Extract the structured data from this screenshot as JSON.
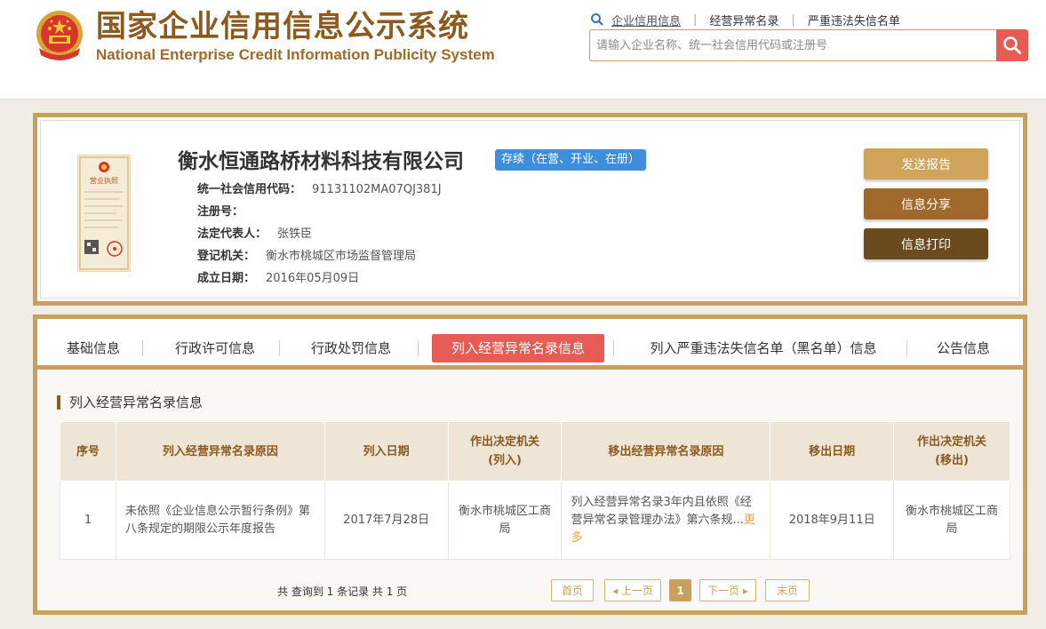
{
  "header": {
    "title_cn": "国家企业信用信息公示系统",
    "title_en": "National Enterprise Credit Information Publicity System",
    "links": [
      {
        "label": "企业信用信息"
      },
      {
        "label": "经营异常名录"
      },
      {
        "label": "严重违法失信名单"
      }
    ],
    "search_placeholder": "请输入企业名称、统一社会信用代码或注册号"
  },
  "company": {
    "name": "衡水恒通路桥材料科技有限公司",
    "status": "存续（在营、开业、在册）",
    "license_label": "营业执照",
    "fields": [
      {
        "label": "统一社会信用代码：",
        "value": "91131102MA07QJ381J"
      },
      {
        "label": "注册号：",
        "value": ""
      },
      {
        "label": "法定代表人：",
        "value": "张铁臣"
      },
      {
        "label": "登记机关：",
        "value": "衡水市桃城区市场监督管理局"
      },
      {
        "label": "成立日期：",
        "value": "2016年05月09日"
      }
    ],
    "actions": {
      "send_report": "发送报告",
      "share": "信息分享",
      "print": "信息打印"
    }
  },
  "tabs": [
    {
      "label": "基础信息"
    },
    {
      "label": "行政许可信息"
    },
    {
      "label": "行政处罚信息"
    },
    {
      "label": "列入经营异常名录信息"
    },
    {
      "label": "列入严重违法失信名单（黑名单）信息"
    },
    {
      "label": "公告信息"
    }
  ],
  "section": {
    "title": "列入经营异常名录信息",
    "columns": [
      {
        "l1": "序号",
        "l2": ""
      },
      {
        "l1": "列入经营异常名录原因",
        "l2": ""
      },
      {
        "l1": "列入日期",
        "l2": ""
      },
      {
        "l1": "作出决定机关",
        "l2": "(列入)"
      },
      {
        "l1": "移出经营异常名录原因",
        "l2": ""
      },
      {
        "l1": "移出日期",
        "l2": ""
      },
      {
        "l1": "作出决定机关",
        "l2": "(移出)"
      }
    ],
    "rows": [
      {
        "no": "1",
        "reason_in": "未依照《企业信息公示暂行条例》第八条规定的期限公示年度报告",
        "date_in": "2017年7月28日",
        "authority_in": "衡水市桃城区工商局",
        "reason_out": "列入经营异常名录3年内且依照《经营异常名录管理办法》第六条规...",
        "more": "更多",
        "date_out": "2018年9月11日",
        "authority_out": "衡水市桃城区工商局"
      }
    ]
  },
  "pagination": {
    "summary": "共 查询到 1 条记录 共 1 页",
    "first": "首页",
    "prev": "上一页",
    "current": "1",
    "next": "下一页",
    "last": "末页"
  },
  "colors": {
    "brand_gold": "#c9a05a",
    "brand_brown": "#8b5a1e",
    "accent_red": "#e65c55",
    "status_blue": "#3d8fde",
    "btn_send": "#cfa45a",
    "btn_share": "#a0682a",
    "btn_print": "#6b4a1e"
  }
}
